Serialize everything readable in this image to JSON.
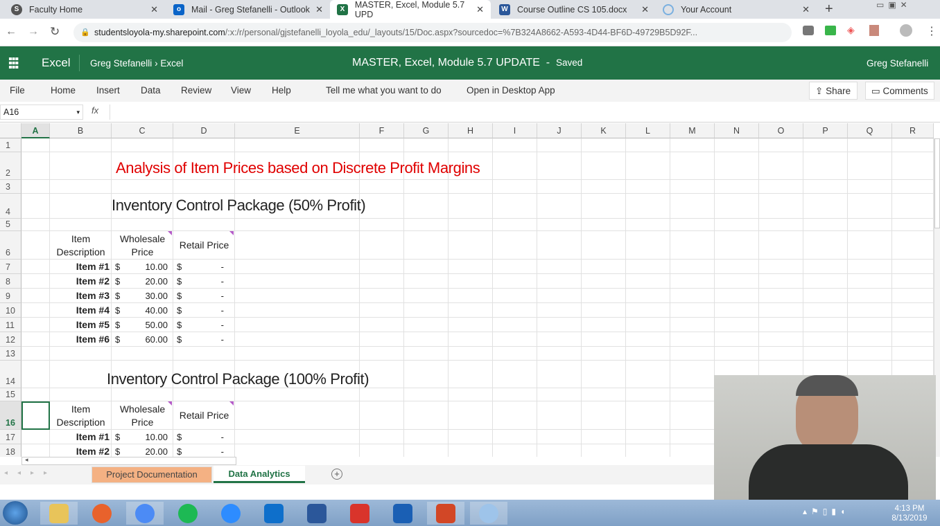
{
  "browser": {
    "tabs": [
      {
        "title": "Faculty Home",
        "icon": "globe-icon",
        "color": "#555"
      },
      {
        "title": "Mail - Greg Stefanelli - Outlook",
        "icon": "outlook-icon",
        "color": "#0a64c8"
      },
      {
        "title": "MASTER, Excel, Module 5.7 UPD",
        "icon": "excel-icon",
        "color": "#217346"
      },
      {
        "title": "Course Outline CS 105.docx",
        "icon": "word-icon",
        "color": "#2b579a"
      },
      {
        "title": "Your Account",
        "icon": "account-icon",
        "color": "#7ab0e0"
      }
    ],
    "url_host": "studentsloyola-my.sharepoint.com",
    "url_path": "/:x:/r/personal/gjstefanelli_loyola_edu/_layouts/15/Doc.aspx?sourcedoc=%7B324A8662-A593-4D44-BF6D-49729B5D92F..."
  },
  "excel": {
    "app": "Excel",
    "breadcrumb_owner": "Greg Stefanelli",
    "breadcrumb_sep": "›",
    "breadcrumb_app": "Excel",
    "doc_title": "MASTER, Excel, Module 5.7 UPDATE",
    "title_sep": "-",
    "save_status": "Saved",
    "user": "Greg Stefanelli",
    "brand_color": "#217346"
  },
  "ribbon": {
    "menu": [
      "File",
      "Home",
      "Insert",
      "Data",
      "Review",
      "View",
      "Help"
    ],
    "tell_me": "Tell me what you want to do",
    "open_desktop": "Open in Desktop App",
    "share": "Share",
    "comments": "Comments"
  },
  "formula_bar": {
    "name_box": "A16",
    "fx": "fx",
    "value": ""
  },
  "sheet": {
    "columns": [
      "A",
      "B",
      "C",
      "D",
      "E",
      "F",
      "G",
      "H",
      "I",
      "J",
      "K",
      "L",
      "M",
      "N",
      "O",
      "P",
      "Q",
      "R"
    ],
    "rows": [
      "1",
      "2",
      "3",
      "4",
      "5",
      "6",
      "7",
      "8",
      "9",
      "10",
      "11",
      "12",
      "13",
      "14",
      "15",
      "16",
      "17",
      "18"
    ],
    "selected_cell": "A16",
    "title": "Analysis of Item Prices based on Discrete Profit Margins",
    "title_color": "#e00000",
    "tables": [
      {
        "heading": "Inventory Control Package (50% Profit)",
        "headers": [
          "Item Description",
          "Wholesale Price",
          "Retail Price"
        ],
        "rows": [
          [
            "Item #1",
            "$",
            "10.00",
            "$",
            "-"
          ],
          [
            "Item #2",
            "$",
            "20.00",
            "$",
            "-"
          ],
          [
            "Item #3",
            "$",
            "30.00",
            "$",
            "-"
          ],
          [
            "Item #4",
            "$",
            "40.00",
            "$",
            "-"
          ],
          [
            "Item #5",
            "$",
            "50.00",
            "$",
            "-"
          ],
          [
            "Item #6",
            "$",
            "60.00",
            "$",
            "-"
          ]
        ]
      },
      {
        "heading": "Inventory Control Package (100% Profit)",
        "headers": [
          "Item Description",
          "Wholesale Price",
          "Retail Price"
        ],
        "rows": [
          [
            "Item #1",
            "$",
            "10.00",
            "$",
            "-"
          ],
          [
            "Item #2",
            "$",
            "20.00",
            "$",
            "-"
          ]
        ]
      }
    ],
    "tabs": [
      {
        "label": "Project Documentation",
        "color": "#f4b183",
        "active": false
      },
      {
        "label": "Data Analytics",
        "active": true
      }
    ]
  },
  "taskbar": {
    "apps": [
      "explorer",
      "firefox",
      "chrome",
      "spotify",
      "zoom",
      "teamviewer",
      "word",
      "ccleaner",
      "malwarebytes",
      "powerpoint",
      "cortana"
    ],
    "time": "4:13 PM",
    "date": "8/13/2019"
  }
}
